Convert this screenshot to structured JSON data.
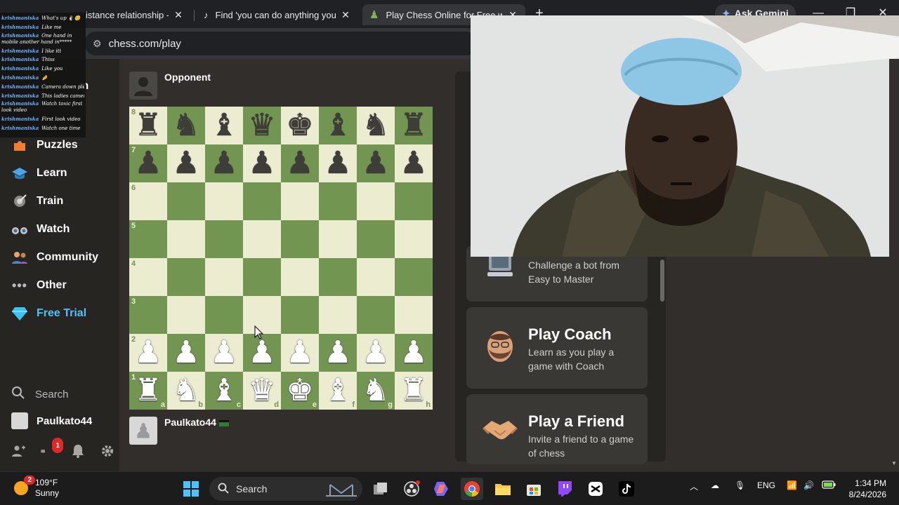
{
  "browser": {
    "tabs": [
      {
        "title": "istance relationship -",
        "active": false
      },
      {
        "title": "Find 'you can do anything you w",
        "active": false
      },
      {
        "title": "Play Chess Online for Free with",
        "active": true
      }
    ],
    "gemini_label": "Ask Gemini",
    "url": "chess.com/play"
  },
  "chat": {
    "username": "krishmaniska",
    "messages": [
      "What's up 🐧😊",
      "Like me",
      "One hand in mobile another hand in*****",
      "I like itt",
      "Thiss",
      "Like you",
      "🤌",
      "Camera down please",
      "This ladies camera",
      "Watch toxic first look video",
      "First look video",
      "Watch one time"
    ]
  },
  "sidebar": {
    "partial_letter": "m",
    "items": [
      {
        "label": "Puzzles"
      },
      {
        "label": "Learn"
      },
      {
        "label": "Train"
      },
      {
        "label": "Watch"
      },
      {
        "label": "Community"
      },
      {
        "label": "Other"
      },
      {
        "label": "Free Trial"
      }
    ],
    "search_label": "Search",
    "username": "Paulkato44",
    "mail_badge": "1"
  },
  "game": {
    "opponent": "Opponent",
    "player": "Paulkato44",
    "files": [
      "a",
      "b",
      "c",
      "d",
      "e",
      "f",
      "g",
      "h"
    ],
    "ranks": [
      "8",
      "7",
      "6",
      "5",
      "4",
      "3",
      "2",
      "1"
    ],
    "position": [
      [
        "br",
        "bn",
        "bb",
        "bq",
        "bk",
        "bb",
        "bn",
        "br"
      ],
      [
        "bp",
        "bp",
        "bp",
        "bp",
        "bp",
        "bp",
        "bp",
        "bp"
      ],
      [
        "",
        "",
        "",
        "",
        "",
        "",
        "",
        ""
      ],
      [
        "",
        "",
        "",
        "",
        "",
        "",
        "",
        ""
      ],
      [
        "",
        "",
        "",
        "",
        "",
        "",
        "",
        ""
      ],
      [
        "",
        "",
        "",
        "",
        "",
        "",
        "",
        ""
      ],
      [
        "wp",
        "wp",
        "wp",
        "wp",
        "wp",
        "wp",
        "wp",
        "wp"
      ],
      [
        "wr",
        "wn",
        "wb",
        "wq",
        "wk",
        "wb",
        "wn",
        "wr"
      ]
    ]
  },
  "panel": {
    "bots_sub": "Challenge a bot from Easy to Master",
    "coach_title": "Play Coach",
    "coach_sub": "Learn as you play a game with Coach",
    "friend_title": "Play a Friend",
    "friend_sub": "Invite a friend to a game of chess"
  },
  "taskbar": {
    "temp": "109°F",
    "condition": "Sunny",
    "weather_badge": "2",
    "search_label": "Search",
    "lang": "ENG",
    "time": "1:34 PM",
    "date": "8/24/2026"
  }
}
